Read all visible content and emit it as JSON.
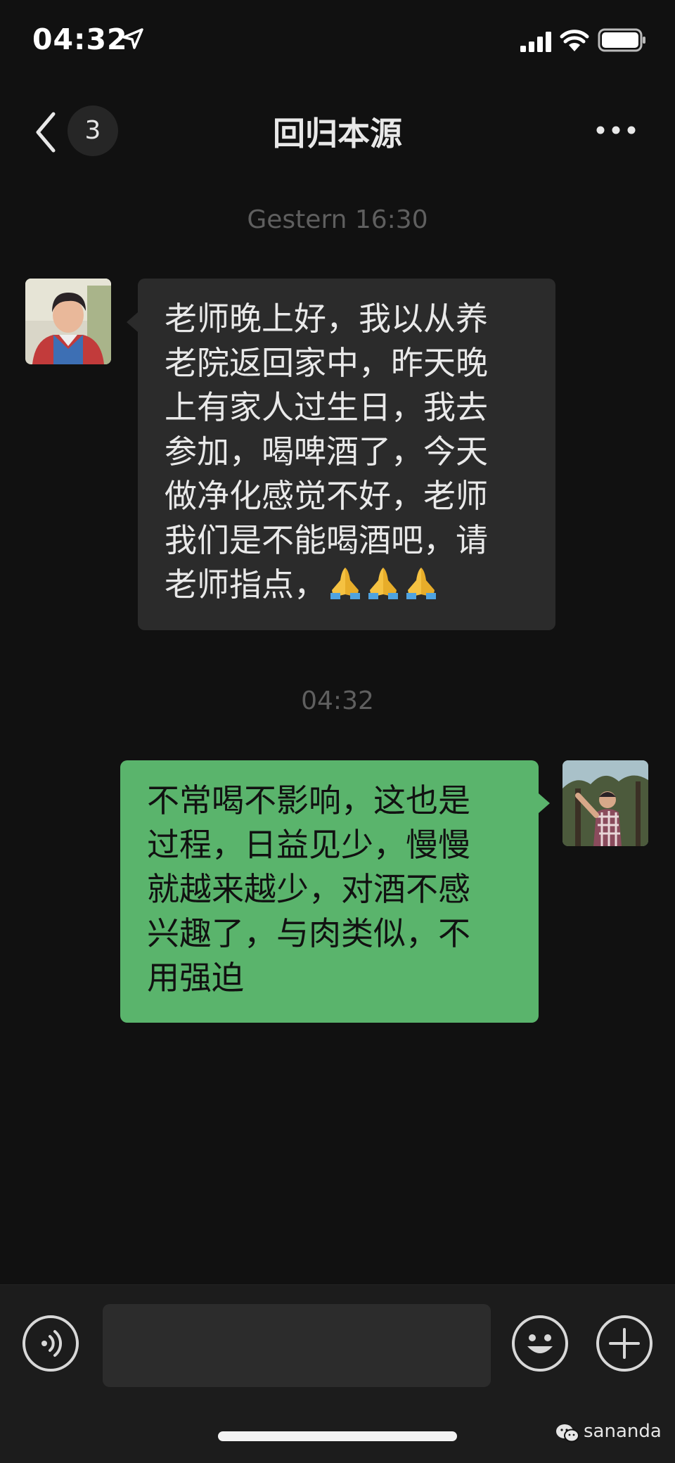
{
  "status_bar": {
    "time": "04:32",
    "icons": [
      "location-arrow-icon",
      "cellular-signal-icon",
      "wifi-icon",
      "battery-icon"
    ]
  },
  "header": {
    "unread_count": "3",
    "title": "回归本源",
    "icons": [
      "back-chevron-icon",
      "more-dots-icon"
    ]
  },
  "messages": [
    {
      "timestamp": "Gestern 16:30",
      "direction": "incoming",
      "lines": [
        "老师晚上好，我以从养",
        "老院返回家中，昨天晚",
        "上有家人过生日，我去",
        "参加，喝啤酒了，今天",
        "做净化感觉不好，老师",
        "我们是不能喝酒吧，请",
        "老师指点，"
      ],
      "emoji": [
        "folded-hands-emoji",
        "folded-hands-emoji",
        "folded-hands-emoji"
      ]
    },
    {
      "timestamp": "04:32",
      "direction": "outgoing",
      "lines": [
        "不常喝不影响，这也是",
        "过程，日益见少，慢慢",
        "就越来越少，对酒不感",
        "兴趣了，与肉类似，不",
        "用强迫"
      ]
    }
  ],
  "input_bar": {
    "text_value": "",
    "icons": [
      "voice-icon",
      "emoji-smiley-icon",
      "add-plus-icon"
    ]
  },
  "watermark": {
    "text": "sananda",
    "icon": "wechat-icon"
  },
  "colors": {
    "background": "#111111",
    "incoming_bubble": "#2b2b2b",
    "outgoing_bubble": "#5ab46c",
    "timestamp": "#5f5f5f"
  }
}
